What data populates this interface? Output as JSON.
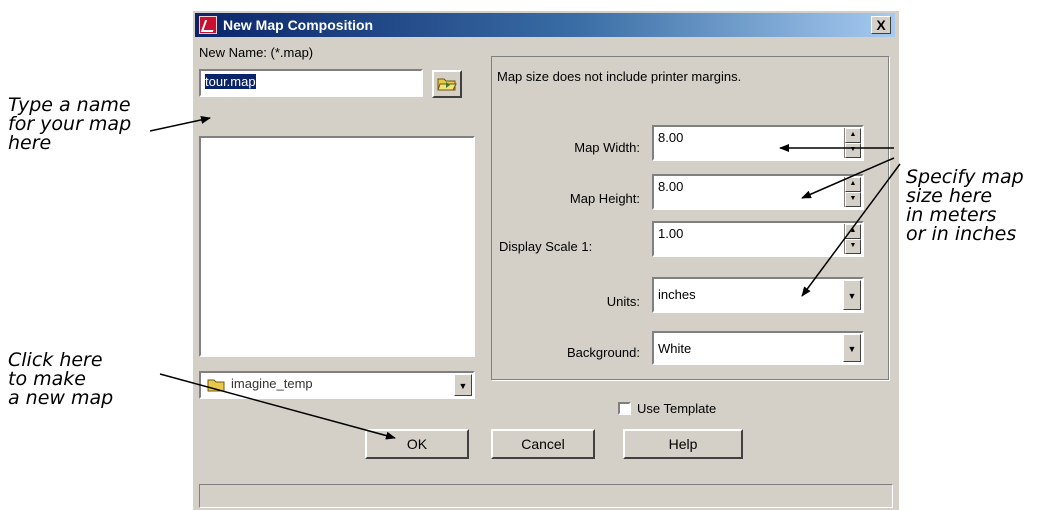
{
  "window": {
    "title": "New Map Composition",
    "close_label": "X"
  },
  "left": {
    "name_label": "New Name: (*.map)",
    "name_value": "tour.map",
    "folder_value": "imagine_temp"
  },
  "right": {
    "note": "Map size does not include printer margins.",
    "fields": [
      {
        "label": "Map Width:",
        "value": "8.00"
      },
      {
        "label": "Map Height:",
        "value": "8.00"
      },
      {
        "label": "Display Scale 1:",
        "value": "1.00"
      }
    ],
    "units_label": "Units:",
    "units_value": "inches",
    "background_label": "Background:",
    "background_value": "White",
    "use_template_label": "Use Template",
    "use_template_checked": false
  },
  "buttons": {
    "ok": "OK",
    "cancel": "Cancel",
    "help": "Help"
  },
  "annotations": {
    "name": [
      "Type a name",
      "for your map",
      "here"
    ],
    "size": [
      "Specify map",
      "size here",
      "in meters",
      "or in inches"
    ],
    "ok": [
      "Click here",
      "to make",
      "a new map"
    ]
  },
  "icons": {
    "open_folder": "open-folder-icon",
    "folder": "folder-icon",
    "app": "app-icon"
  }
}
